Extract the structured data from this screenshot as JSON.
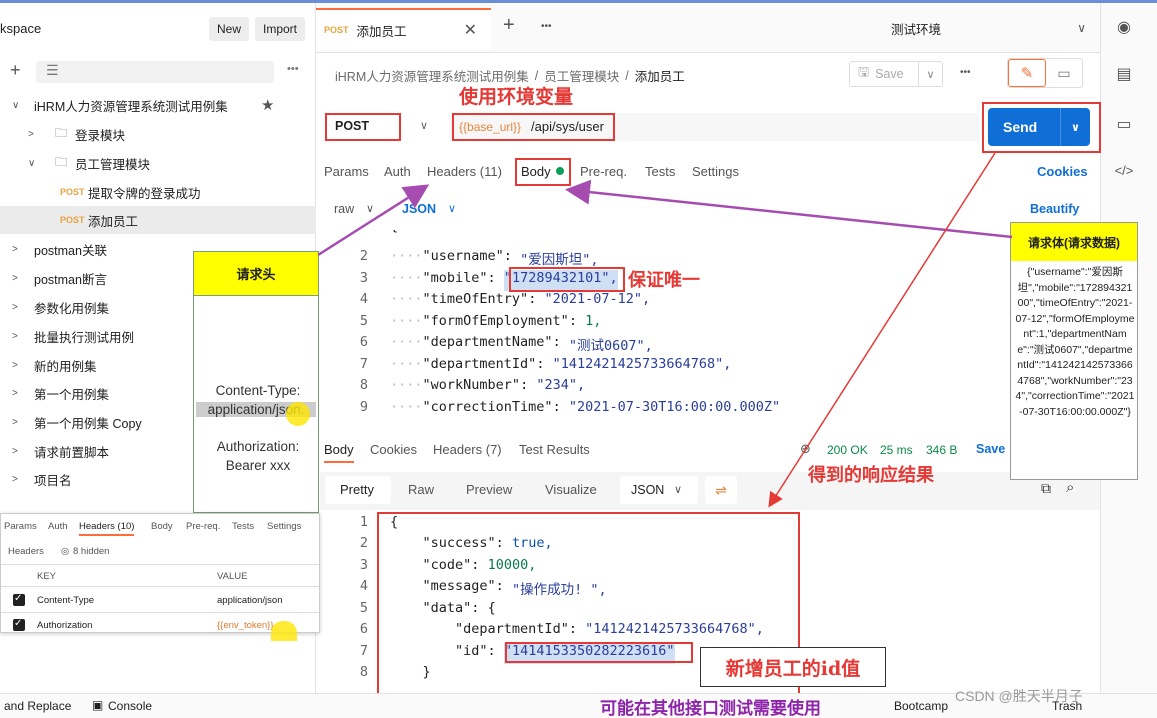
{
  "sidebar": {
    "workspace_title": "kspace",
    "new_label": "New",
    "import_label": "Import",
    "collections": [
      {
        "label": "iHRM人力资源管理系统测试用例集",
        "expanded": true
      },
      {
        "label": "登录模块",
        "folder": true
      },
      {
        "label": "员工管理模块",
        "folder": true,
        "expanded": true
      },
      {
        "label": "提取令牌的登录成功",
        "method": "POST"
      },
      {
        "label": "添加员工",
        "method": "POST",
        "active": true
      },
      {
        "label": "postman关联"
      },
      {
        "label": "postman断言"
      },
      {
        "label": "参数化用例集"
      },
      {
        "label": "批量执行测试用例"
      },
      {
        "label": "新的用例集"
      },
      {
        "label": "第一个用例集"
      },
      {
        "label": "第一个用例集 Copy"
      },
      {
        "label": "请求前置脚本"
      },
      {
        "label": "项目名"
      }
    ]
  },
  "req_head_popup": {
    "title": "请求头",
    "content_type_label": "Content-Type:",
    "content_type_value": "application/json.",
    "auth_label": "Authorization:",
    "auth_value": "Bearer xxx"
  },
  "headers_popup": {
    "tabs": [
      "Params",
      "Auth",
      "Headers (10)",
      "Body",
      "Pre-req.",
      "Tests",
      "Settings"
    ],
    "headers_label": "Headers",
    "hidden_label": "8 hidden",
    "col_key": "KEY",
    "col_value": "VALUE",
    "rows": [
      {
        "key": "Content-Type",
        "value": "application/json"
      },
      {
        "key": "Authorization",
        "value": "{{env_token}}"
      }
    ]
  },
  "tab": {
    "method": "POST",
    "name": "添加员工"
  },
  "environment": "测试环境",
  "breadcrumb": {
    "root": "iHRM人力资源管理系统测试用例集",
    "folder": "员工管理模块",
    "current": "添加员工"
  },
  "save_label": "Save",
  "request": {
    "method": "POST",
    "url_var": "{{base_url}}",
    "url_path": "/api/sys/user",
    "send_label": "Send"
  },
  "request_tabs": {
    "params": "Params",
    "auth": "Auth",
    "headers": "Headers (11)",
    "body": "Body",
    "prereq": "Pre-req.",
    "tests": "Tests",
    "settings": "Settings",
    "cookies": "Cookies"
  },
  "body_mode": {
    "raw": "raw",
    "json": "JSON",
    "beautify": "Beautify"
  },
  "request_body": [
    {
      "n": "1",
      "k": "",
      "v": "{"
    },
    {
      "n": "2",
      "k": "\"username\"",
      "v": "\"爱因斯坦\","
    },
    {
      "n": "3",
      "k": "\"mobile\"",
      "v": "\"17289432101\","
    },
    {
      "n": "4",
      "k": "\"timeOfEntry\"",
      "v": "\"2021-07-12\","
    },
    {
      "n": "5",
      "k": "\"formOfEmployment\"",
      "v": "1,"
    },
    {
      "n": "6",
      "k": "\"departmentName\"",
      "v": "\"测试0607\","
    },
    {
      "n": "7",
      "k": "\"departmentId\"",
      "v": "\"1412421425733664768\","
    },
    {
      "n": "8",
      "k": "\"workNumber\"",
      "v": "\"234\","
    },
    {
      "n": "9",
      "k": "\"correctionTime\"",
      "v": "\"2021-07-30T16:00:00.000Z\""
    }
  ],
  "response_tabs": {
    "body": "Body",
    "cookies": "Cookies",
    "headers": "Headers (7)",
    "tests": "Test Results",
    "status": "200 OK",
    "time": "25 ms",
    "size": "346 B",
    "save": "Save"
  },
  "view_tabs": {
    "pretty": "Pretty",
    "raw": "Raw",
    "preview": "Preview",
    "visualize": "Visualize",
    "format": "JSON"
  },
  "response_body": [
    {
      "n": "1",
      "text": "{"
    },
    {
      "n": "2",
      "k": "\"success\"",
      "v": "true,",
      "t": "kw"
    },
    {
      "n": "3",
      "k": "\"code\"",
      "v": "10000,",
      "t": "num"
    },
    {
      "n": "4",
      "k": "\"message\"",
      "v": "\"操作成功! \",",
      "t": "str"
    },
    {
      "n": "5",
      "k": "\"data\"",
      "v": "{",
      "t": "key"
    },
    {
      "n": "6",
      "k": "\"departmentId\"",
      "v": "\"1412421425733664768\",",
      "t": "str"
    },
    {
      "n": "7",
      "k": "\"id\"",
      "v": "\"1414153350282223616\"",
      "t": "str"
    },
    {
      "n": "8",
      "text": "}"
    }
  ],
  "annotations": {
    "env_var": "使用环境变量",
    "unique": "保证唯一",
    "response": "得到的响应结果",
    "new_id": "新增员工的id值",
    "bottom": "可能在其他接口测试需要使用"
  },
  "req_body_popup": {
    "title": "请求体(请求数据)",
    "text": "{\"username\":\"爱因斯坦\",\"mobile\":\"17289432100\",\"timeOfEntry\":\"2021-07-12\",\"formOfEmployment\":1,\"departmentName\":\"测试0607\",\"departmentId\":\"1412421425733664768\",\"workNumber\":\"234\",\"correctionTime\":\"2021-07-30T16:00:00.000Z\"}"
  },
  "bottom_bar": {
    "find_replace": "and Replace",
    "console": "Console",
    "bootcamp": "Bootcamp",
    "trash": "Trash"
  },
  "watermark": "CSDN @胜天半月子"
}
